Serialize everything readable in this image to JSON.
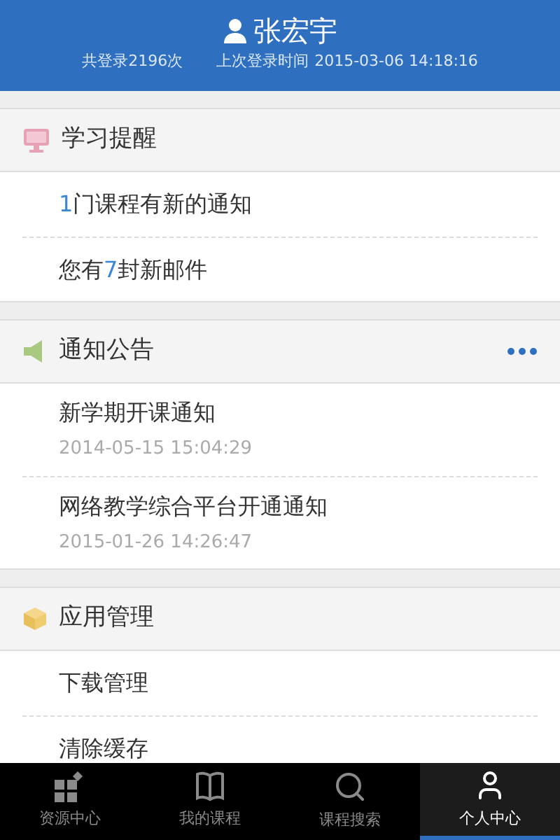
{
  "header": {
    "user_name": "张宏宇",
    "login_count": "共登录2196次",
    "last_login_label": "上次登录时间",
    "last_login_time": "2015-03-06 14:18:16"
  },
  "sections": [
    {
      "kind": "reminder",
      "title": "学习提醒",
      "more": false,
      "items": [
        {
          "segments": [
            {
              "text": "1",
              "highlight": true
            },
            {
              "text": "门课程有新的通知",
              "highlight": false
            }
          ]
        },
        {
          "segments": [
            {
              "text": "您有",
              "highlight": false
            },
            {
              "text": "7",
              "highlight": true
            },
            {
              "text": "封新邮件",
              "highlight": false
            }
          ]
        }
      ]
    },
    {
      "kind": "notice",
      "title": "通知公告",
      "more": true,
      "items": [
        {
          "segments": [
            {
              "text": "新学期开课通知",
              "highlight": false
            }
          ],
          "date": "2014-05-15 15:04:29"
        },
        {
          "segments": [
            {
              "text": "网络教学综合平台开通通知",
              "highlight": false
            }
          ],
          "date": "2015-01-26 14:26:47"
        }
      ]
    },
    {
      "kind": "apps",
      "title": "应用管理",
      "more": false,
      "items": [
        {
          "segments": [
            {
              "text": "下载管理",
              "highlight": false
            }
          ]
        },
        {
          "segments": [
            {
              "text": "清除缓存",
              "highlight": false
            }
          ]
        }
      ]
    }
  ],
  "tabs": [
    {
      "kind": "resources",
      "label": "资源中心",
      "selected": false
    },
    {
      "kind": "courses",
      "label": "我的课程",
      "selected": false
    },
    {
      "kind": "search",
      "label": "课程搜索",
      "selected": false
    },
    {
      "kind": "profile",
      "label": "个人中心",
      "selected": true
    }
  ]
}
